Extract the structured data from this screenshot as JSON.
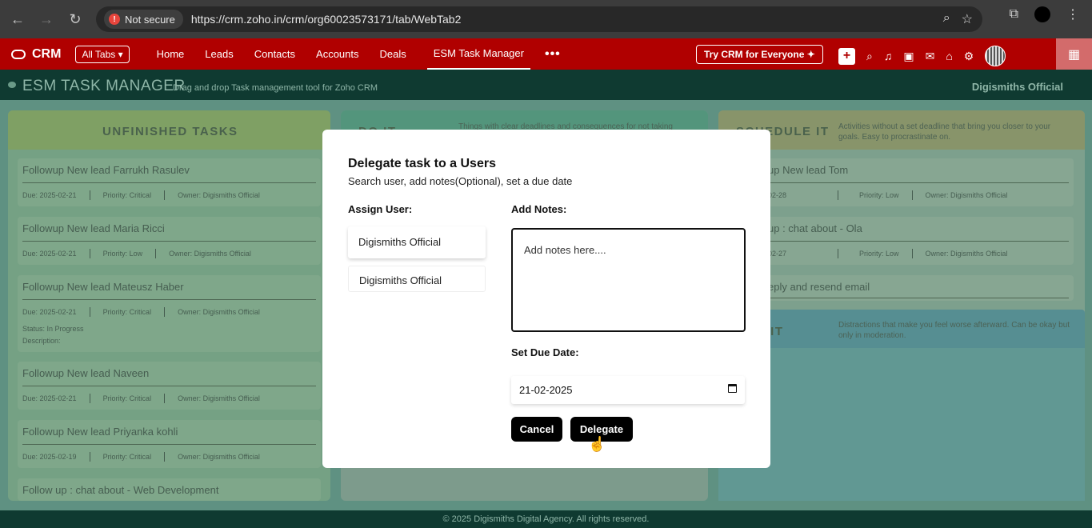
{
  "browser": {
    "security_label": "Not secure",
    "url": "https://crm.zoho.in/crm/org60023573171/tab/WebTab2"
  },
  "crm_nav": {
    "logo": "CRM",
    "all_tabs": "All Tabs",
    "items": [
      "Home",
      "Leads",
      "Contacts",
      "Accounts",
      "Deals",
      "ESM Task Manager"
    ],
    "active_item": "ESM Task Manager",
    "more": "•••",
    "try_crm": "Try CRM for Everyone ✦"
  },
  "app": {
    "title": "ESM TASK MANAGER",
    "subtitle": "Drag and drop Task management tool for Zoho CRM",
    "user": "Digismiths Official",
    "footer": "© 2025 Digismiths Digital Agency. All rights reserved."
  },
  "columns": {
    "unfinished": {
      "title": "UNFINISHED TASKS",
      "cards": [
        {
          "title": "Followup New lead Farrukh Rasulev",
          "due": "Due: 2025-02-21",
          "priority": "Priority: Critical",
          "owner": "Owner: Digismiths Official"
        },
        {
          "title": "Followup New lead Maria Ricci",
          "due": "Due: 2025-02-21",
          "priority": "Priority: Low",
          "owner": "Owner: Digismiths Official"
        },
        {
          "title": "Followup New lead Mateusz Haber",
          "due": "Due: 2025-02-21",
          "priority": "Priority: Critical",
          "owner": "Owner: Digismiths Official",
          "status": "Status: In Progress",
          "description": "Description:"
        },
        {
          "title": "Followup New lead Naveen",
          "due": "Due: 2025-02-21",
          "priority": "Priority: Critical",
          "owner": "Owner: Digismiths Official"
        },
        {
          "title": "Followup New lead Priyanka kohli",
          "due": "Due: 2025-02-19",
          "priority": "Priority: Critical",
          "owner": "Owner: Digismiths Official"
        },
        {
          "title": "Follow up : chat about - Web Development"
        }
      ]
    },
    "do_it": {
      "title": "DO IT",
      "description": "Things with clear deadlines and consequences for not taking"
    },
    "schedule_it": {
      "title": "SCHEDULE IT",
      "description": "Activities without a set deadline that bring you closer to your goals. Easy to procrastinate on.",
      "cards": [
        {
          "title": "up New lead Tom",
          "due": "02-28",
          "priority": "Priority: Low",
          "owner": "Owner: Digismiths Official"
        },
        {
          "title": "up : chat about - Ola",
          "due": "02-27",
          "priority": "Priority: Low",
          "owner": "Owner: Digismiths Official"
        },
        {
          "title": "eply and resend email"
        }
      ]
    },
    "delete_it": {
      "title": "E IT",
      "description": "Distractions that make you feel worse afterward. Can be okay but only in moderation."
    }
  },
  "modal": {
    "title": "Delegate task to a Users",
    "subtitle": "Search user, add notes(Optional), set a due date",
    "assign_label": "Assign User:",
    "users": [
      "Digismiths Official",
      "Digismiths Official"
    ],
    "notes_label": "Add Notes:",
    "notes_placeholder": "Add notes here....",
    "due_label": "Set Due Date:",
    "due_value": "21-02-2025",
    "cancel": "Cancel",
    "delegate": "Delegate"
  }
}
